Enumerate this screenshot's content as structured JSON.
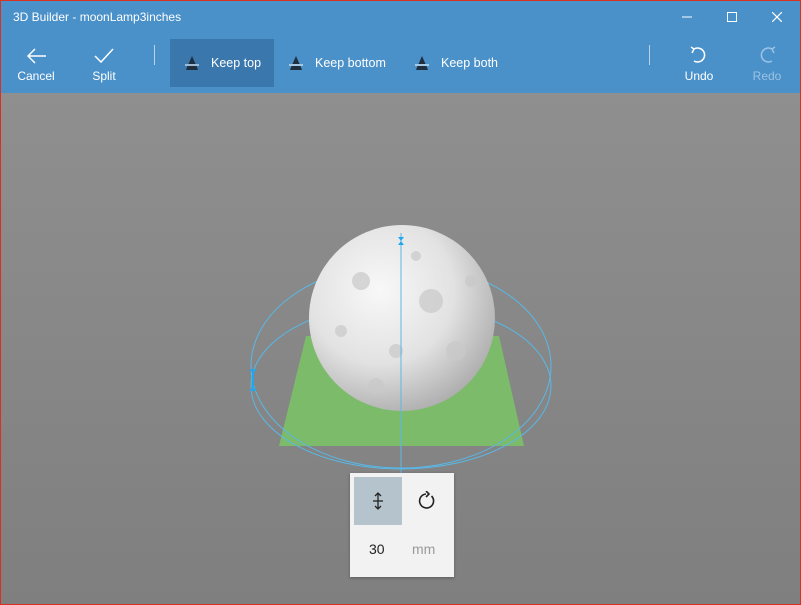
{
  "window": {
    "title": "3D Builder - moonLamp3inches"
  },
  "controls": {
    "minimize_icon": "minimize-icon",
    "maximize_icon": "maximize-icon",
    "close_icon": "close-icon"
  },
  "toolbar": {
    "cancel_label": "Cancel",
    "split_label": "Split",
    "keep_top_label": "Keep top",
    "keep_bottom_label": "Keep bottom",
    "keep_both_label": "Keep both",
    "undo_label": "Undo",
    "redo_label": "Redo",
    "active_mode": "Keep top"
  },
  "panel": {
    "move_icon": "move-icon",
    "rotate_icon": "rotate-icon",
    "value": "30",
    "unit": "mm",
    "active_tool": "move"
  },
  "colors": {
    "titlebar": "#4a90c9",
    "active_button": "#3a77ac",
    "plane": "#7cbb6a",
    "gizmo": "#4fb8e8",
    "background": "#8a8a8a"
  }
}
